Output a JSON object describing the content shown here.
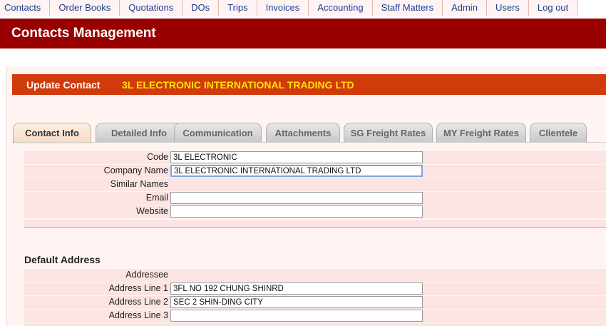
{
  "nav": [
    "Contacts",
    "Order Books",
    "Quotations",
    "DOs",
    "Trips",
    "Invoices",
    "Accounting",
    "Staff Matters",
    "Admin",
    "Users",
    "Log out"
  ],
  "banner_title": "Contacts Management",
  "update": {
    "label": "Update Contact",
    "name": "3L ELECTRONIC INTERNATIONAL TRADING LTD"
  },
  "tabs": [
    "Contact Info",
    "Detailed Info",
    "Communication",
    "Attachments",
    "SG Freight Rates",
    "MY Freight Rates",
    "Clientele"
  ],
  "fields": {
    "code": {
      "label": "Code",
      "value": "3L ELECTRONIC"
    },
    "company": {
      "label": "Company Name",
      "value": "3L ELECTRONIC INTERNATIONAL TRADING LTD"
    },
    "similar": {
      "label": "Similar Names"
    },
    "email": {
      "label": "Email",
      "value": ""
    },
    "website": {
      "label": "Website",
      "value": ""
    }
  },
  "address": {
    "title": "Default Address",
    "addressee": {
      "label": "Addressee"
    },
    "line1": {
      "label": "Address Line 1",
      "value": "3FL NO 192 CHUNG SHINRD"
    },
    "line2": {
      "label": "Address Line 2",
      "value": "SEC 2 SHIN-DING CITY"
    },
    "line3": {
      "label": "Address Line 3",
      "value": ""
    }
  }
}
